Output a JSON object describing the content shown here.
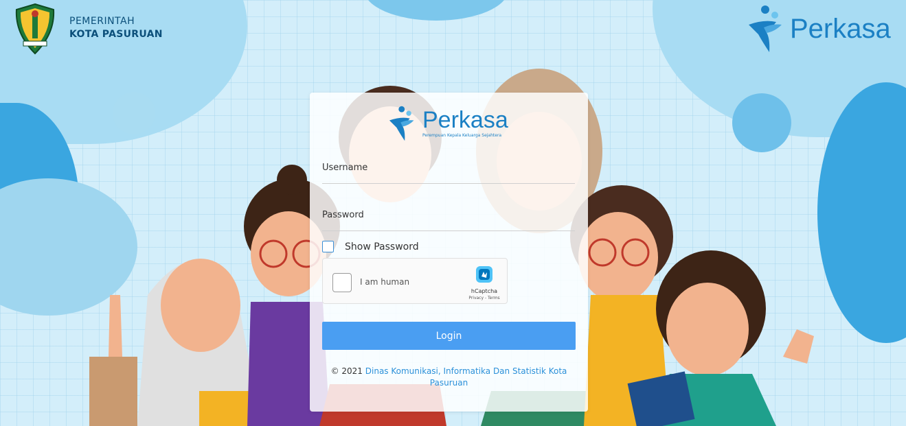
{
  "header": {
    "gov_line1": "PEMERINTAH",
    "gov_line2": "KOTA PASURUAN",
    "brand_name": "Perkasa"
  },
  "login_card": {
    "logo_name": "Perkasa",
    "logo_tagline": "Perempuan Kepala Keluarga Sejahtera",
    "username_label": "Username",
    "username_value": "",
    "password_label": "Password",
    "password_value": "",
    "show_password_label": "Show Password",
    "captcha": {
      "label": "I am human",
      "brand": "hCaptcha",
      "links": "Privacy - Terms"
    },
    "login_label": "Login",
    "footer_prefix": "© 2021",
    "footer_link": "Dinas Komunikasi, Informatika Dan Statistik Kota Pasuruan"
  },
  "colors": {
    "brand_blue": "#1b80c4",
    "button_blue": "#4a9ef2",
    "link_blue": "#2b90d9",
    "gov_text": "#0b4f7a"
  },
  "icons": [
    "pasuruan-crest-icon",
    "perkasa-logo-icon",
    "hcaptcha-icon"
  ]
}
